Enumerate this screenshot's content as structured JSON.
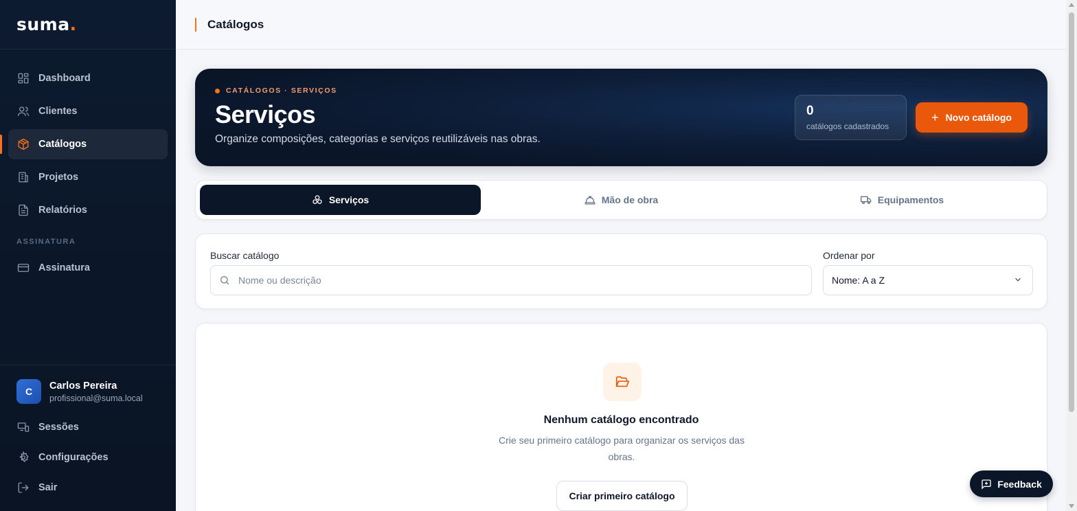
{
  "brand": {
    "name": "suma",
    "dot": "."
  },
  "sidebar": {
    "items": [
      {
        "label": "Dashboard",
        "icon": "layout-grid-icon"
      },
      {
        "label": "Clientes",
        "icon": "users-icon"
      },
      {
        "label": "Catálogos",
        "icon": "package-icon",
        "active": true
      },
      {
        "label": "Projetos",
        "icon": "building-icon"
      },
      {
        "label": "Relatórios",
        "icon": "file-text-icon"
      }
    ],
    "section_label": "ASSINATURA",
    "subscription_item": {
      "label": "Assinatura",
      "icon": "credit-card-icon"
    }
  },
  "user": {
    "initial": "C",
    "name": "Carlos Pereira",
    "email": "profissional@suma.local"
  },
  "bottom_items": [
    {
      "label": "Sessões",
      "icon": "monitor-icon"
    },
    {
      "label": "Configurações",
      "icon": "settings-icon"
    },
    {
      "label": "Sair",
      "icon": "log-out-icon"
    }
  ],
  "topbar": {
    "title": "Catálogos"
  },
  "hero": {
    "kicker": "CATÁLOGOS · SERVIÇOS",
    "title": "Serviços",
    "subtitle": "Organize composições, categorias e serviços reutilizáveis nas obras.",
    "stat_value": "0",
    "stat_label": "catálogos cadastrados",
    "new_button": "Novo catálogo"
  },
  "tabs": [
    {
      "label": "Serviços",
      "icon": "boxes-icon",
      "active": true
    },
    {
      "label": "Mão de obra",
      "icon": "hard-hat-icon"
    },
    {
      "label": "Equipamentos",
      "icon": "truck-icon"
    }
  ],
  "filters": {
    "search_label": "Buscar catálogo",
    "search_placeholder": "Nome ou descrição",
    "search_value": "",
    "sort_label": "Ordenar por",
    "sort_value": "Nome: A a Z"
  },
  "empty_state": {
    "title": "Nenhum catálogo encontrado",
    "description": "Crie seu primeiro catálogo para organizar os serviços das obras.",
    "button": "Criar primeiro catálogo"
  },
  "feedback": {
    "label": "Feedback"
  },
  "colors": {
    "accent": "#f97316",
    "sidebar_bg": "#0d1b30",
    "button_primary": "#ea580c"
  }
}
